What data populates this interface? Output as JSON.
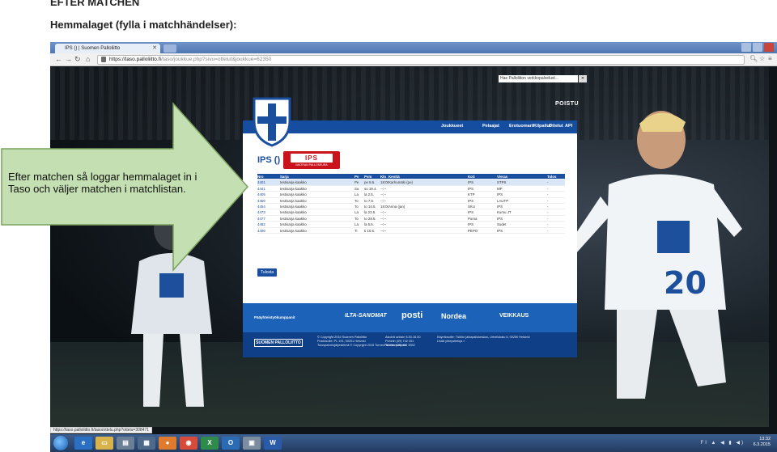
{
  "document": {
    "title": "EFTER MATCHEN",
    "subtitle": "Hemmalaget (fylla i matchhändelser):",
    "callout_line1": "Efter matchen så loggar hemmalaget in i",
    "callout_line2": "Taso och väljer matchen i matchlistan."
  },
  "browser": {
    "tab_title": "IPS () | Suomen Palloliitto",
    "url_host": "https://taso.palloliitto.fi",
    "url_path": "/taso/joukkue.php?sivu=ottelut&joukkue=62350",
    "status_url": "https://taso.palloliitto.fi/taso/ottelu.php?ottelu=308471"
  },
  "site": {
    "search_placeholder": "Hae Palloliiton verkkopalvelust...",
    "logout": "POISTU",
    "nav": [
      "Joukkueet",
      "Pelaajat",
      "Erotuomarit",
      "Kilpailut",
      "Ottelut",
      "API"
    ],
    "team_title": "IPS ()",
    "logo_text": "IPS",
    "logo_small": "IMATRAN PALLOSEURA",
    "table_headers": [
      "Nro",
      "Sarja",
      "Pv",
      "Pvm",
      "Klo",
      "Kenttä",
      "Koti",
      "Vieras",
      "Tulos"
    ],
    "matches": [
      {
        "nro": "4401",
        "sarja": "testisarja kaakko",
        "pv": "Pe",
        "pvm": "pe 8.5.",
        "klo": "18:00",
        "kentta": "Karhumäki (pe)",
        "koti": "IPS",
        "vieras": "STPS",
        "tulos": "-"
      },
      {
        "nro": "4441",
        "sarja": "testisarja kaakko",
        "pv": "Su",
        "pvm": "su 19.4.",
        "klo": "--:--",
        "kentta": "",
        "koti": "IPS",
        "vieras": "MP",
        "tulos": "-"
      },
      {
        "nro": "4405",
        "sarja": "testisarja kaakko",
        "pv": "La",
        "pvm": "la 2.5.",
        "klo": "--:--",
        "kentta": "",
        "koti": "KTP",
        "vieras": "IPS",
        "tulos": "-"
      },
      {
        "nro": "4450",
        "sarja": "testisarja kaakko",
        "pv": "To",
        "pvm": "to 7.5.",
        "klo": "--:--",
        "kentta": "",
        "koti": "IPS",
        "vieras": "LAUTP",
        "tulos": "-"
      },
      {
        "nro": "4454",
        "sarja": "testisarja kaakko",
        "pv": "To",
        "pvm": "to 14.5.",
        "klo": "18:00",
        "kentta": "Arina (jan)",
        "koti": "SKU",
        "vieras": "IPS",
        "tulos": "-"
      },
      {
        "nro": "4473",
        "sarja": "testisarja kaakko",
        "pv": "La",
        "pvm": "la 23.5.",
        "klo": "--:--",
        "kentta": "",
        "koti": "IPS",
        "vieras": "Kumu JT",
        "tulos": "-"
      },
      {
        "nro": "4477",
        "sarja": "testisarja kaakko",
        "pv": "To",
        "pvm": "to 28.5.",
        "klo": "--:--",
        "kentta": "",
        "koti": "Puma",
        "vieras": "IPS",
        "tulos": "-"
      },
      {
        "nro": "4482",
        "sarja": "testisarja kaakko",
        "pv": "La",
        "pvm": "la 6.6.",
        "klo": "--:--",
        "kentta": "",
        "koti": "IPS",
        "vieras": "Sudet",
        "tulos": "-"
      },
      {
        "nro": "4400",
        "sarja": "testisarja kaakko",
        "pv": "Ti",
        "pvm": "ti 10.6.",
        "klo": "--:--",
        "kentta": "",
        "koti": "PEPO",
        "vieras": "IPS",
        "tulos": "-"
      }
    ],
    "print_button": "Tulosta",
    "sponsor_label": "Pääyhteistyökumppanit",
    "sponsors": [
      "ILTA-SANOMAT",
      "posti",
      "Nordea",
      "VEIKKAUS"
    ],
    "footer_logo": "SUOMEN PALLOLIITTO",
    "footer_col1": "© Copyright 2015 Suomen Palloliitto\nPostiosoite: PL 191, 00251 Helsinki\nTulospalvelujärjestelmä © Copyright 2015 TorneoPal International",
    "footer_col2": "Asiointi arkisin 8.30-16.00\nPuhelin (09) 742 151\nTelefax (09) 454 3352",
    "footer_col3": "Käyntiosoite: Töölön jalkapallokeskus, Urheilukatu 5, 00250 Helsinki\nLisää yhteystietoja »"
  },
  "taskbar": {
    "time": "13:32",
    "date": "6.3.2015",
    "tray_icons": "FI ▲ ◀ ▮ ◀)"
  }
}
